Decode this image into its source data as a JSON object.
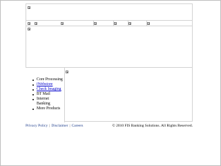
{
  "sidebar": {
    "items": [
      {
        "label": "Core Processing",
        "link": false
      },
      {
        "label": "iWebstore",
        "link": true
      },
      {
        "label": "Check Imaging",
        "link": true
      },
      {
        "label": "BT Mail",
        "link": false
      },
      {
        "label": "Internet Banking",
        "link": false
      },
      {
        "label": "More Products",
        "link": false
      }
    ]
  },
  "footer": {
    "links": [
      "Privacy Policy",
      "Disclaimer",
      "Careers"
    ],
    "separator": "|",
    "copyright": "© 2010 FIS Banking Solutions. All Rights Reserved."
  },
  "colors": {
    "border": "#d2d2d2",
    "link": "#0000cc",
    "footer_link": "#1a3a8a"
  }
}
